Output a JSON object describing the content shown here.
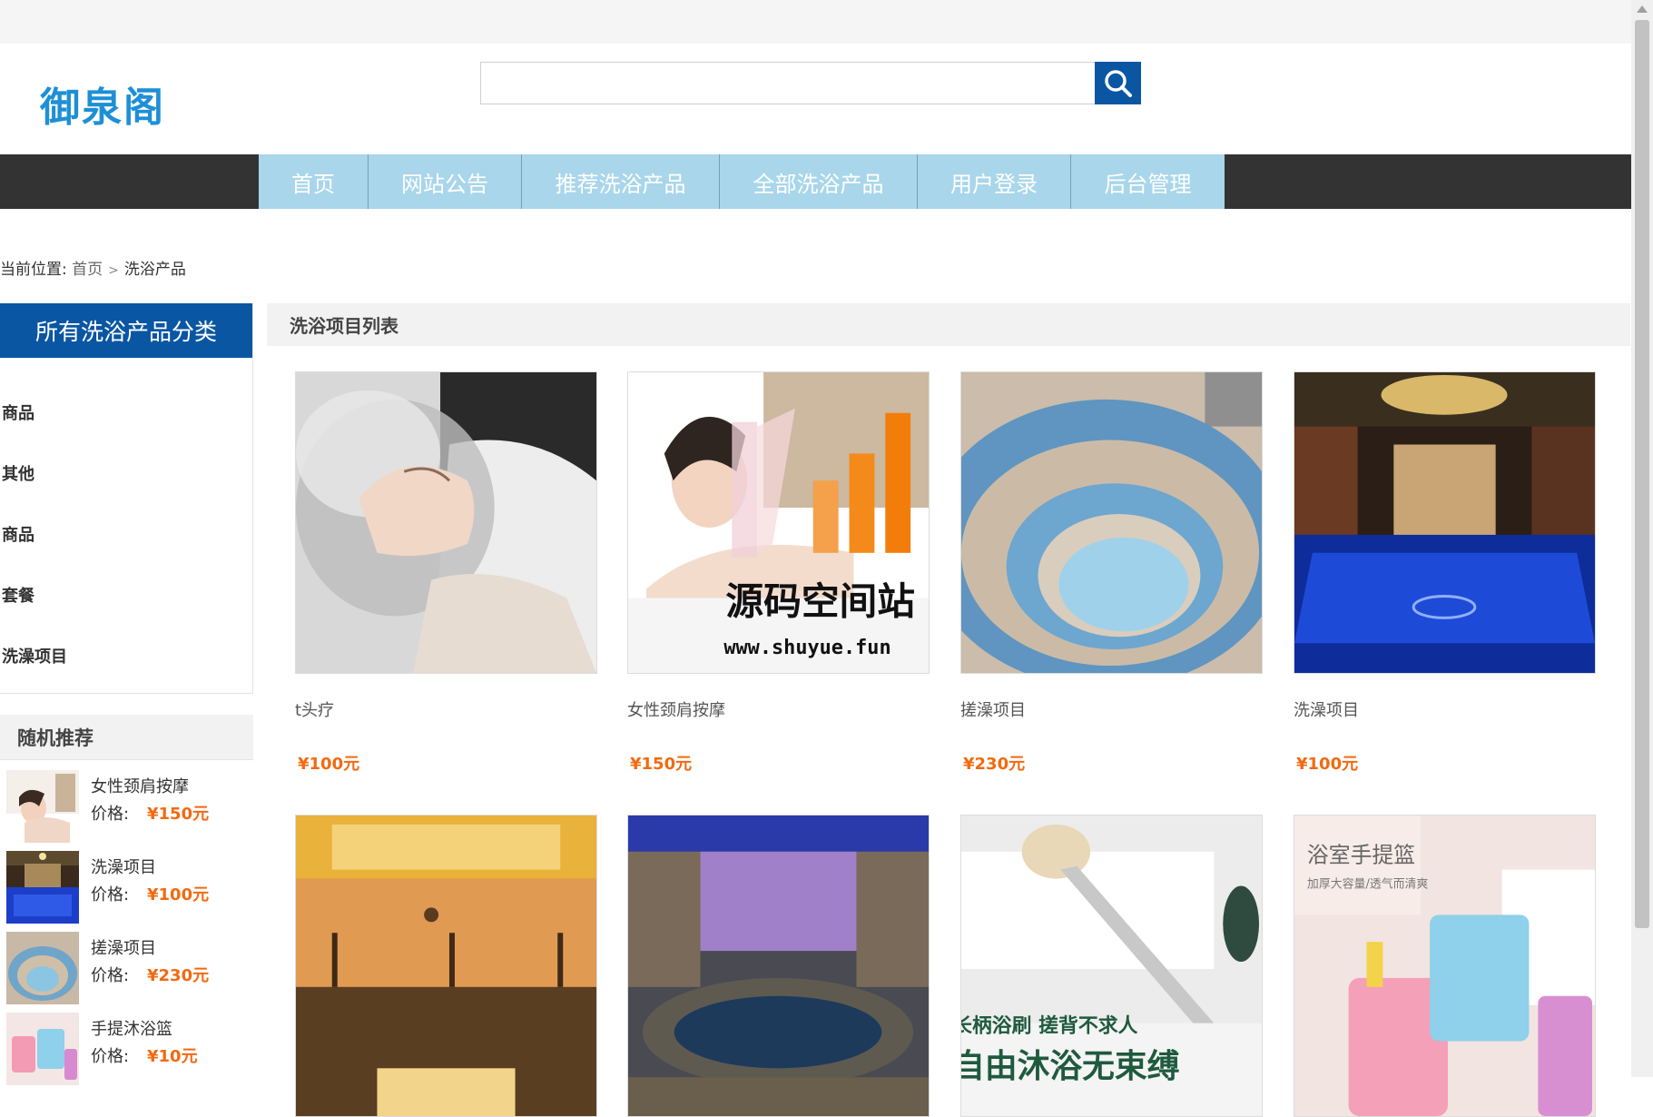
{
  "site": {
    "logo": "御泉阁",
    "search_placeholder": "",
    "search_icon": "search-icon"
  },
  "nav": {
    "items": [
      "首页",
      "网站公告",
      "推荐洗浴产品",
      "全部洗浴产品",
      "用户登录",
      "后台管理"
    ]
  },
  "breadcrumb": {
    "prefix": "当前位置:",
    "home": "首页",
    "current": "洗浴产品"
  },
  "categories": {
    "title": "所有洗浴产品分类",
    "items": [
      "商品",
      "其他",
      "商品",
      "套餐",
      "洗澡项目"
    ]
  },
  "recommend": {
    "title": "随机推荐",
    "price_label": "价格:",
    "items": [
      {
        "name": "女性颈肩按摩",
        "price": "¥150元"
      },
      {
        "name": "洗澡项目",
        "price": "¥100元"
      },
      {
        "name": "搓澡项目",
        "price": "¥230元"
      },
      {
        "name": "手提沐浴篮",
        "price": "¥10元"
      }
    ]
  },
  "products": {
    "title": "洗浴项目列表",
    "items": [
      {
        "name": "t头疗",
        "price": "¥100元"
      },
      {
        "name": "女性颈肩按摩",
        "price": "¥150元"
      },
      {
        "name": "搓澡项目",
        "price": "¥230元"
      },
      {
        "name": "洗澡项目",
        "price": "¥100元"
      },
      {
        "name": "",
        "price": ""
      },
      {
        "name": "",
        "price": ""
      },
      {
        "name": "",
        "price": ""
      },
      {
        "name": "",
        "price": ""
      }
    ]
  },
  "image_text": {
    "watermark_title": "源码空间站",
    "watermark_url": "www.shuyue.fun",
    "brush_line1": "长柄浴刷  搓背不求人",
    "brush_line2": "自由沐浴无束缚",
    "basket_title": "浴室手提篮",
    "basket_sub": "加厚大容量/透气而清爽"
  },
  "colors": {
    "accent_blue": "#0a56a3",
    "nav_item": "#a9d6ea",
    "nav_bar": "#333333",
    "price": "#f26a10",
    "logo": "#1e8fd6"
  }
}
